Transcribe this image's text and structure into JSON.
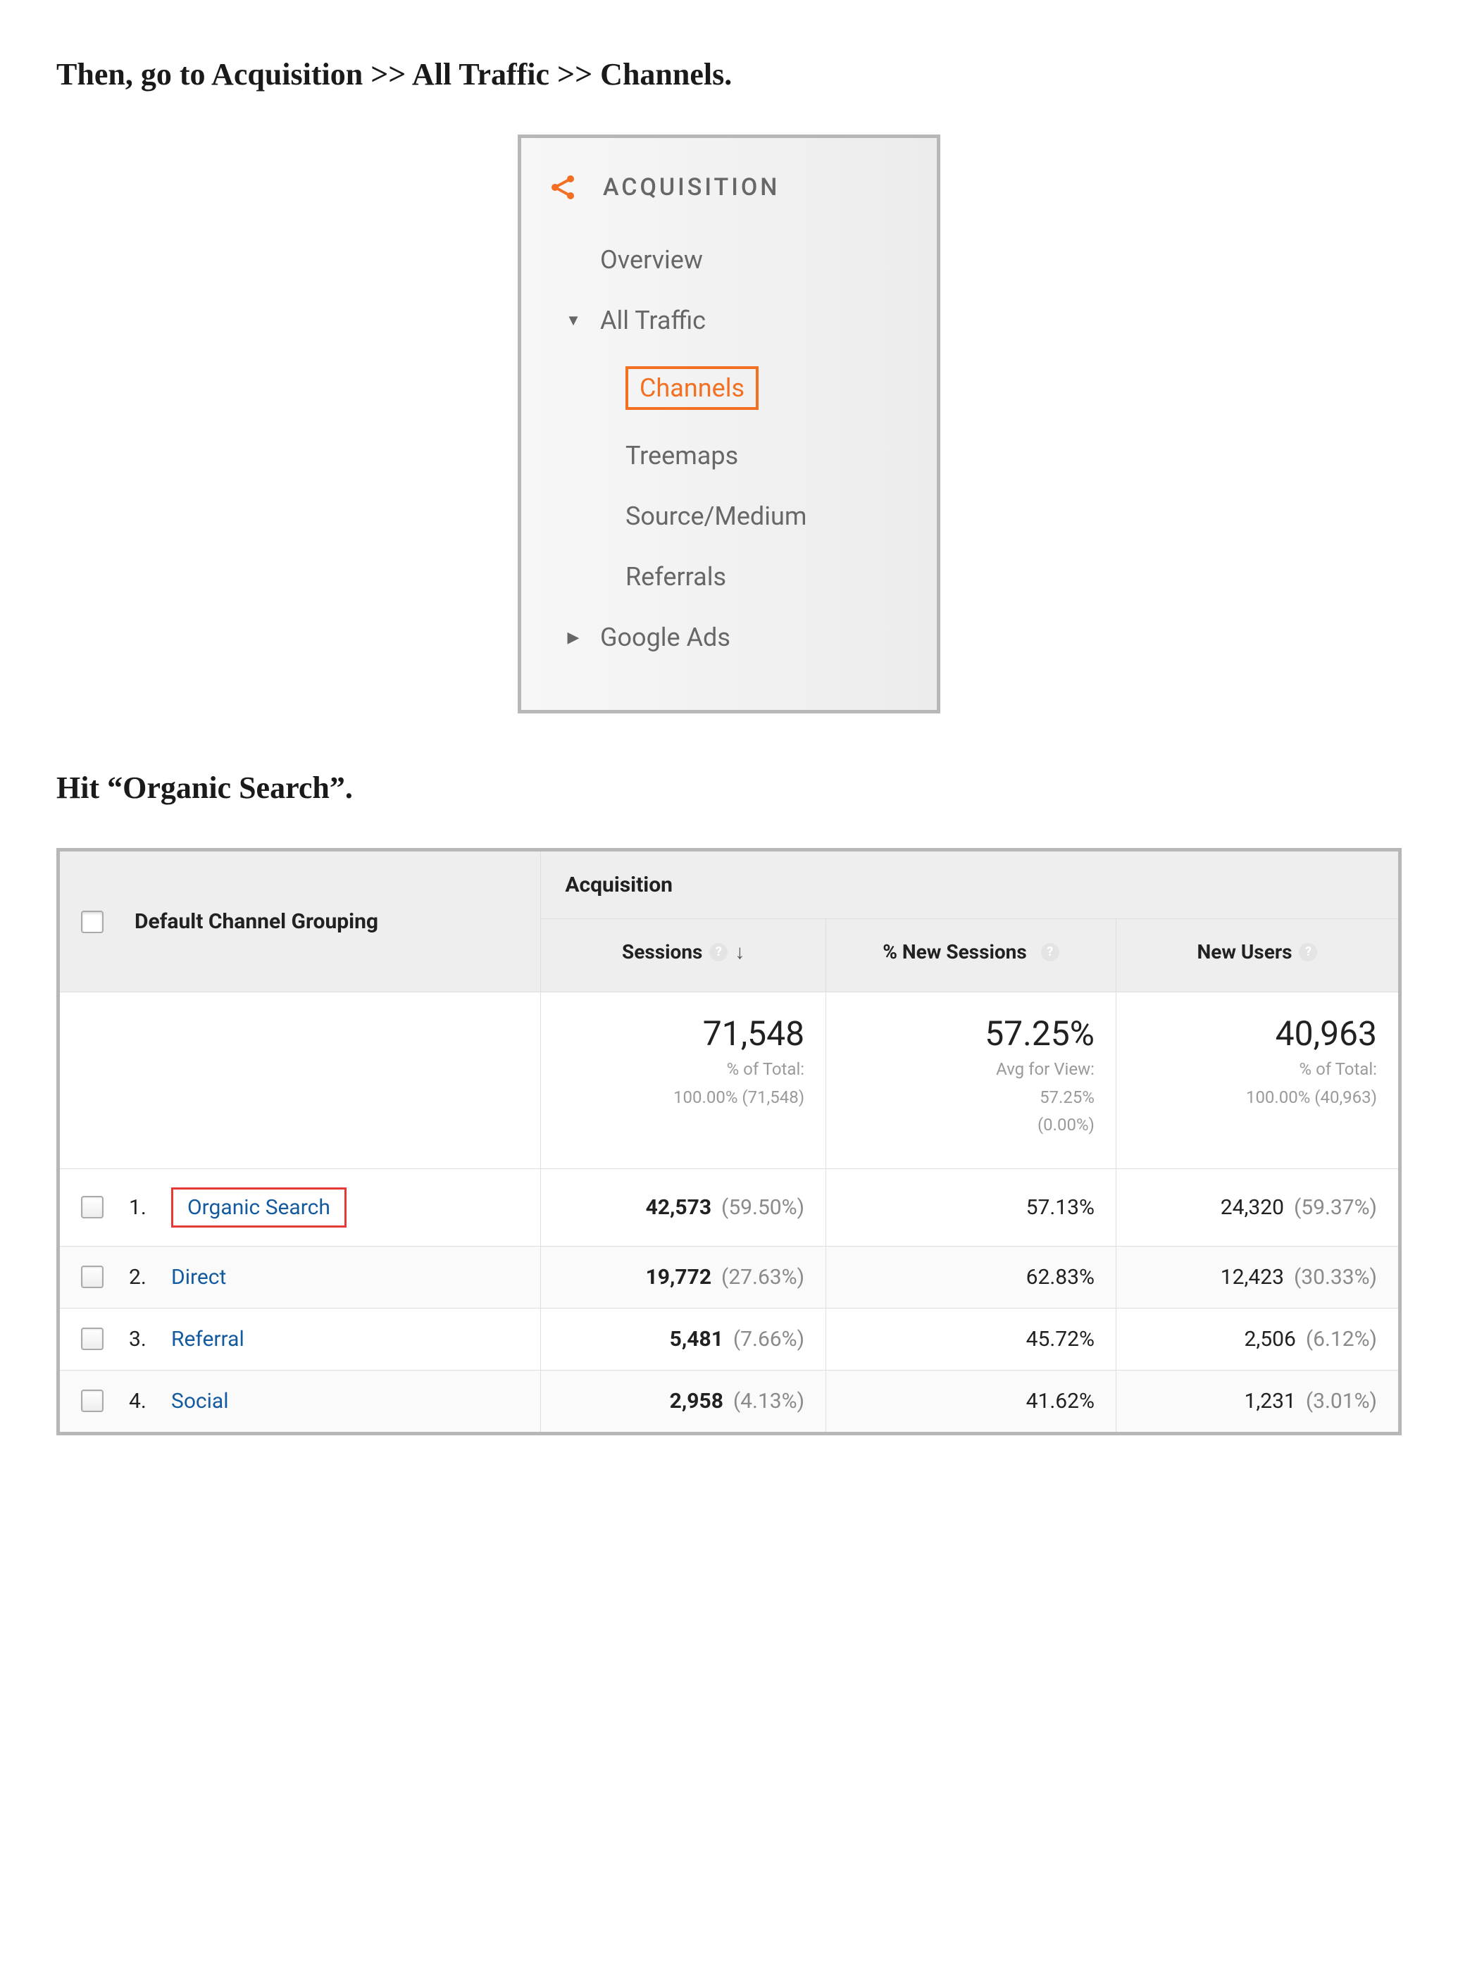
{
  "instruction1": "Then, go to Acquisition >> All Traffic >> Channels.",
  "instruction2": "Hit “Organic Search”.",
  "sidenav": {
    "section_title": "ACQUISITION",
    "overview": "Overview",
    "all_traffic": "All Traffic",
    "channels": "Channels",
    "treemaps": "Treemaps",
    "source_medium": "Source/Medium",
    "referrals": "Referrals",
    "google_ads": "Google Ads"
  },
  "table": {
    "dimension_header": "Default Channel Grouping",
    "group_header": "Acquisition",
    "metrics": {
      "sessions": "Sessions",
      "new_sessions": "% New Sessions",
      "new_users": "New Users"
    },
    "totals": {
      "sessions": {
        "value": "71,548",
        "sub1": "% of Total:",
        "sub2": "100.00% (71,548)"
      },
      "new_sessions": {
        "value": "57.25%",
        "sub1": "Avg for View:",
        "sub2": "57.25%",
        "sub3": "(0.00%)"
      },
      "new_users": {
        "value": "40,963",
        "sub1": "% of Total:",
        "sub2": "100.00% (40,963)"
      }
    },
    "rows": [
      {
        "idx": "1.",
        "name": "Organic Search",
        "highlight": true,
        "sessions_val": "42,573",
        "sessions_pct": "(59.50%)",
        "newsess": "57.13%",
        "newusers_val": "24,320",
        "newusers_pct": "(59.37%)"
      },
      {
        "idx": "2.",
        "name": "Direct",
        "highlight": false,
        "sessions_val": "19,772",
        "sessions_pct": "(27.63%)",
        "newsess": "62.83%",
        "newusers_val": "12,423",
        "newusers_pct": "(30.33%)"
      },
      {
        "idx": "3.",
        "name": "Referral",
        "highlight": false,
        "sessions_val": "5,481",
        "sessions_pct": "(7.66%)",
        "newsess": "45.72%",
        "newusers_val": "2,506",
        "newusers_pct": "(6.12%)"
      },
      {
        "idx": "4.",
        "name": "Social",
        "highlight": false,
        "sessions_val": "2,958",
        "sessions_pct": "(4.13%)",
        "newsess": "41.62%",
        "newusers_val": "1,231",
        "newusers_pct": "(3.01%)"
      }
    ]
  }
}
